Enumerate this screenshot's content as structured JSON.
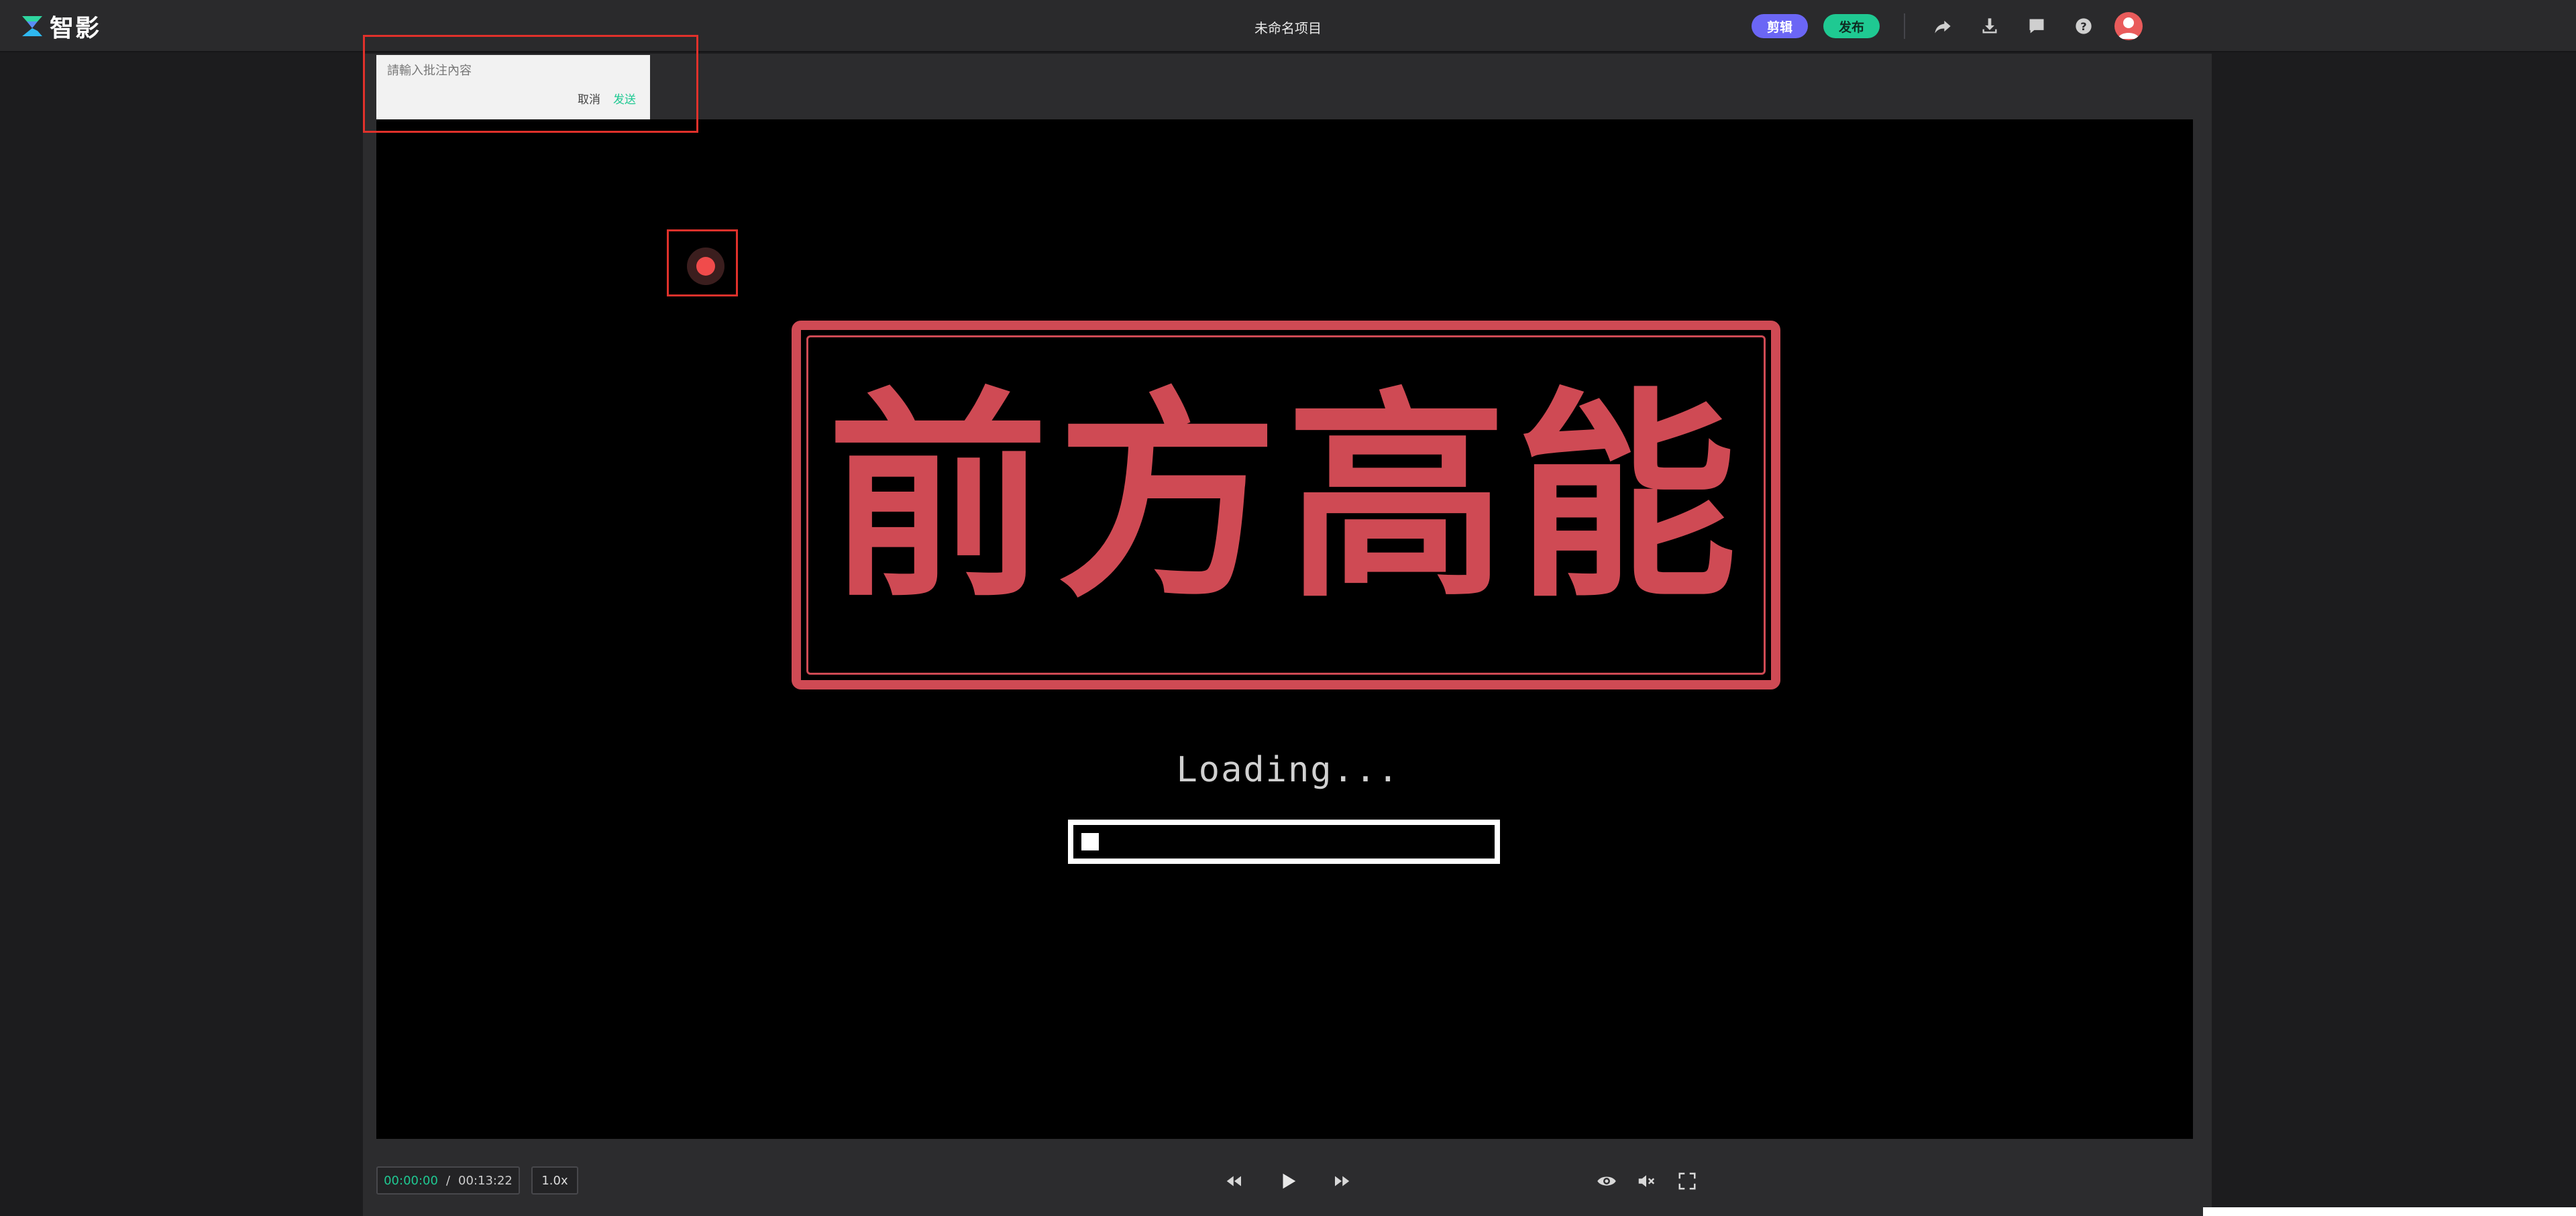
{
  "app": {
    "name": "智影",
    "project_title": "未命名项目"
  },
  "toolbar": {
    "edit_label": "剪辑",
    "publish_label": "发布",
    "edit_color": "#6b66f5",
    "publish_color": "#1fc992",
    "icons": [
      "share-icon",
      "download-icon",
      "comment-icon",
      "help-icon",
      "avatar"
    ]
  },
  "comment": {
    "placeholder": "請輸入批注內容",
    "cancel_label": "取消",
    "send_label": "发送"
  },
  "video": {
    "sign_text": "前方高能",
    "loading_text": "Loading..."
  },
  "player": {
    "current_time": "00:00:00",
    "separator": "/",
    "total_time": "00:13:22",
    "speed": "1.0x"
  }
}
